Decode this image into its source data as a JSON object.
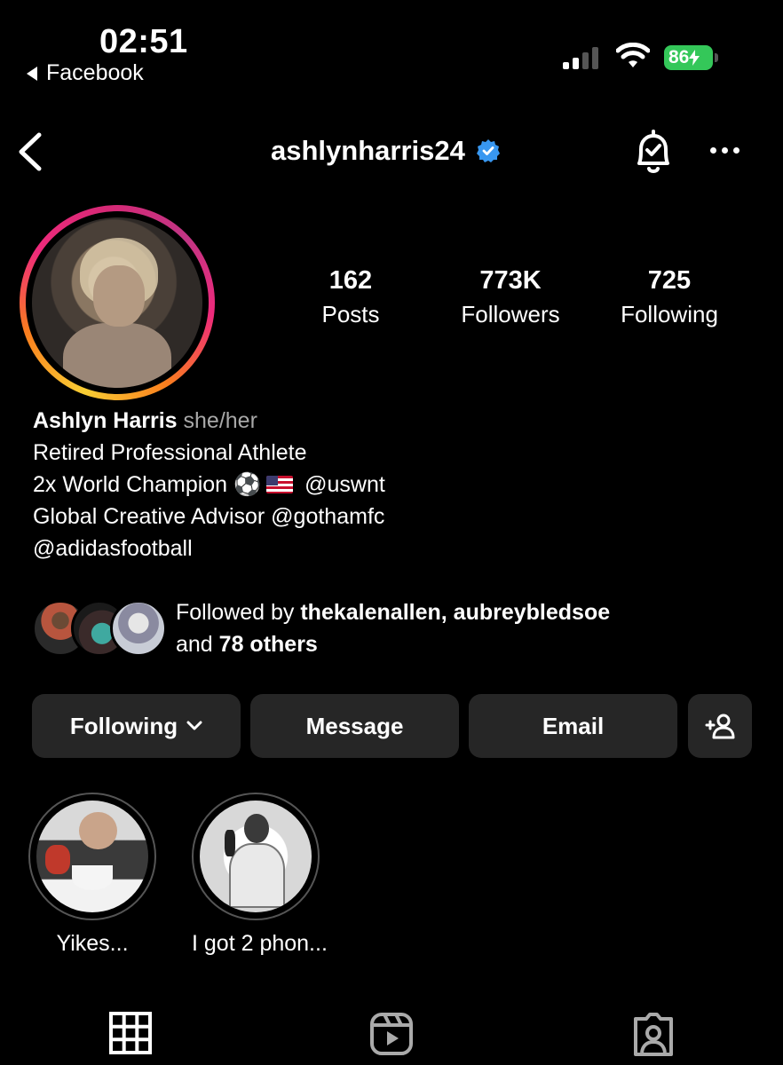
{
  "status_bar": {
    "time": "02:51",
    "back_app": "Facebook",
    "battery": "86"
  },
  "header": {
    "username": "ashlynharris24",
    "verified": true,
    "icons": [
      "chevron-left-icon",
      "verified-badge-icon",
      "bell-check-icon",
      "more-icon"
    ]
  },
  "stats": [
    {
      "value": "162",
      "label": "Posts"
    },
    {
      "value": "773K",
      "label": "Followers"
    },
    {
      "value": "725",
      "label": "Following"
    }
  ],
  "bio": {
    "name": "Ashlyn Harris",
    "pronouns": "she/her",
    "line1": "Retired Professional Athlete",
    "line2_prefix": "2x World Champion",
    "line2_emoji": "⚽",
    "line2_mention": "@uswnt",
    "line3": "Global Creative Advisor @gothamfc",
    "line4": "@adidasfootball"
  },
  "mutual": {
    "prefix": "Followed by",
    "user1": "thekalenallen",
    "separator": ",",
    "user2": "aubreybledsoe",
    "and": "and",
    "others": "78 others"
  },
  "buttons": {
    "following": "Following",
    "message": "Message",
    "email": "Email"
  },
  "highlights": [
    {
      "label": "Yikes..."
    },
    {
      "label": "I got 2 phon..."
    }
  ],
  "tabs": [
    "grid-icon",
    "reels-icon",
    "tagged-icon"
  ],
  "colors": {
    "background": "#000000",
    "button": "#262626",
    "verified": "#3897f0",
    "battery": "#34c759",
    "secondary_text": "#a8a8a8"
  }
}
